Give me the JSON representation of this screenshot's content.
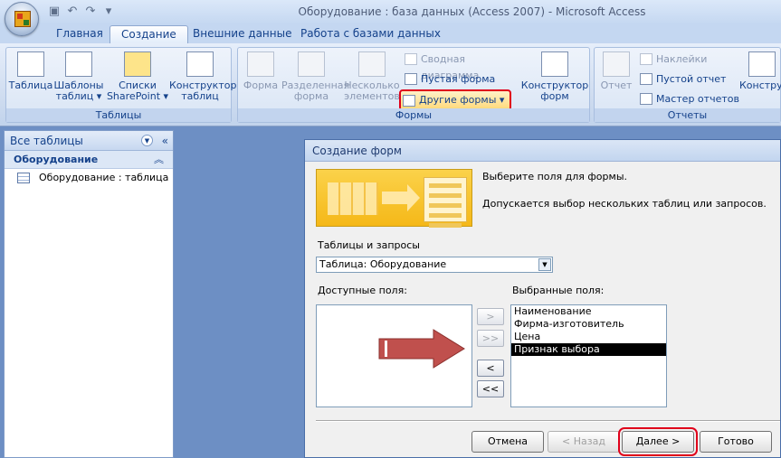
{
  "window": {
    "title": "Оборудование : база данных (Access 2007) - Microsoft Access"
  },
  "quick_access": {
    "icons": [
      "save-icon",
      "undo-icon",
      "redo-icon",
      "customize-icon"
    ]
  },
  "ribbon": {
    "tabs": [
      {
        "label": "Главная"
      },
      {
        "label": "Создание",
        "active": true
      },
      {
        "label": "Внешние данные"
      },
      {
        "label": "Работа с базами данных"
      }
    ],
    "groups": {
      "tables": {
        "label": "Таблицы",
        "buttons": [
          "Таблица",
          "Шаблоны таблиц",
          "Списки SharePoint",
          "Конструктор таблиц"
        ]
      },
      "forms": {
        "label": "Формы",
        "buttons": [
          "Форма",
          "Разделенная форма",
          "Несколько элементов",
          "Конструктор форм"
        ],
        "small": [
          "Сводная диаграмма",
          "Пустая форма",
          "Другие формы"
        ]
      },
      "reports": {
        "label": "Отчеты",
        "buttons": [
          "Отчет",
          "Конструктор отчетов"
        ],
        "small": [
          "Наклейки",
          "Пустой отчет",
          "Мастер отчетов"
        ]
      }
    }
  },
  "nav_pane": {
    "header": "Все таблицы",
    "group": "Оборудование",
    "items": [
      "Оборудование : таблица"
    ]
  },
  "dialog": {
    "title": "Создание форм",
    "prompt": "Выберите поля для формы.",
    "hint": "Допускается выбор нескольких таблиц или запросов.",
    "tables_label": "Таблицы и запросы",
    "tables_value": "Таблица: Оборудование",
    "available_label": "Доступные поля:",
    "selected_label": "Выбранные поля:",
    "selected_fields": [
      "Наименование",
      "Фирма-изготовитель",
      "Цена",
      "Признак выбора"
    ],
    "move": {
      "one": ">",
      "all": ">>",
      "back_one": "<",
      "back_all": "<<"
    },
    "buttons": {
      "cancel": "Отмена",
      "back": "< Назад",
      "next": "Далее >",
      "finish": "Готово"
    }
  }
}
